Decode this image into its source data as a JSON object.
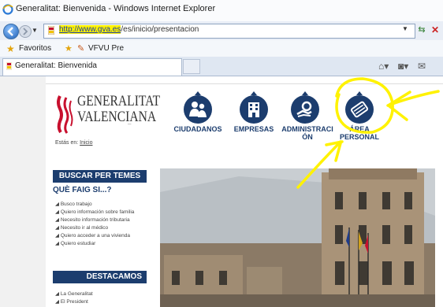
{
  "browser": {
    "window_title": "Generalitat: Bienvenida - Windows Internet Explorer",
    "address": {
      "url_highlight": "http://www.gva.es",
      "url_rest": "/es/inicio/presentacion"
    },
    "favorites_label": "Favoritos",
    "favorite_link": "VFVU Pre",
    "tab_label": "Generalitat: Bienvenida"
  },
  "site": {
    "logo_line1": "GENERALITAT",
    "logo_line2": "VALENCIANA",
    "nav": [
      {
        "label": "CIUDADANOS"
      },
      {
        "label": "EMPRESAS"
      },
      {
        "label": "ADMINISTRACIÓN"
      },
      {
        "label": "ÁREA PERSONAL"
      }
    ],
    "breadcrumb_prefix": "Estás en:",
    "breadcrumb_link": "Inicio",
    "buscar_title": "BUSCAR PER TEMES",
    "que_faig_title": "QUÈ FAIG SI...?",
    "que_faig_items": [
      "Busco trabajo",
      "Quiero información sobre familia",
      "Necesito información tributaria",
      "Necesito ir al médico",
      "Quiero acceder a una vivienda",
      "Quiero estudiar"
    ],
    "destacamos_title": "DESTACAMOS",
    "destacamos_items": [
      "La Generalitat",
      "El President"
    ]
  },
  "colors": {
    "brand_navy": "#1c3d6e",
    "annotation_yellow": "#fff200"
  },
  "icons": {
    "nav": [
      "people-icon",
      "building-icon",
      "gear-hand-icon",
      "card-icon"
    ],
    "browser": [
      "ie-logo-icon",
      "back-icon",
      "forward-icon",
      "refresh-icon",
      "stop-icon",
      "star-icon",
      "home-icon",
      "feed-icon",
      "mail-icon"
    ]
  }
}
